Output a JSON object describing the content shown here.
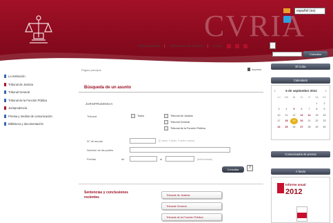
{
  "header": {
    "wordmark": "CVRIA",
    "language_select": "español (es)",
    "nav": [
      "Página principal",
      "Información de contacto",
      "Avisos"
    ],
    "font_buttons": [
      "A",
      "A",
      "A"
    ],
    "search_button": "Consultar"
  },
  "sidebar": {
    "items": [
      {
        "label": "La Institución"
      },
      {
        "label": "Tribunal de Justicia"
      },
      {
        "label": "Tribunal General"
      },
      {
        "label": "Tribunal de la Función Pública"
      },
      {
        "label": "Jurisprudencia"
      },
      {
        "label": "Prensa y medios de comunicación"
      },
      {
        "label": "Biblioteca y documentación"
      }
    ]
  },
  "main": {
    "breadcrumb": "Página principal",
    "print_label": "Imprimir",
    "title": "Búsqueda de un asunto",
    "section": "JURISPRUDENCIA",
    "tribunal_label": "Tribunal",
    "todos": "Todos",
    "tribunales": [
      "Tribunal de Justicia",
      "Tribunal General",
      "Tribunal de la Función Pública"
    ],
    "asunto_label": "N° de asunto",
    "asunto_hint": "(C-xx/xx, T-xx/xx, F-xx/xx o xx/xx)",
    "partes_label": "Nombre de las partes",
    "fechas_label": "Fechas",
    "del_label": "de",
    "al_label": "al",
    "date_hint": "(dd/mm/aaaa)",
    "consultar": "Consultar",
    "help": "?",
    "results_title": "Sentencias y conclusiones recientes",
    "result_buttons": [
      "Tribunal de Justicia",
      "Tribunal General",
      "Tribunal de la Función Pública"
    ]
  },
  "right": {
    "curia_bar": "El Curia",
    "calendar_bar": "Calendario",
    "month": "6 de septiembre 2012",
    "prev": "‹",
    "next": "›",
    "weekdays": [
      "LU",
      "MA",
      "MI",
      "JU",
      "VI",
      "SA",
      "DO"
    ],
    "weeks": [
      [
        "",
        "",
        "",
        "",
        "",
        "1",
        "2"
      ],
      [
        "3",
        "4",
        "5",
        "6",
        "7",
        "8",
        "9"
      ],
      [
        "10",
        "11",
        "12",
        "13",
        "14",
        "15",
        "16"
      ],
      [
        "17",
        "18",
        "19",
        "20",
        "21",
        "22",
        "23"
      ],
      [
        "24",
        "25",
        "26",
        "27",
        "28",
        "29",
        "30"
      ]
    ],
    "press_bar": "Comunicados de prensa",
    "glance_bar": "A fondo",
    "annual_title": "Informe anual",
    "annual_year": "2012"
  },
  "colors": {
    "header": "#a31127",
    "accent": "#9b0f22",
    "today": "#e6b21d",
    "button": "#3d4452"
  }
}
